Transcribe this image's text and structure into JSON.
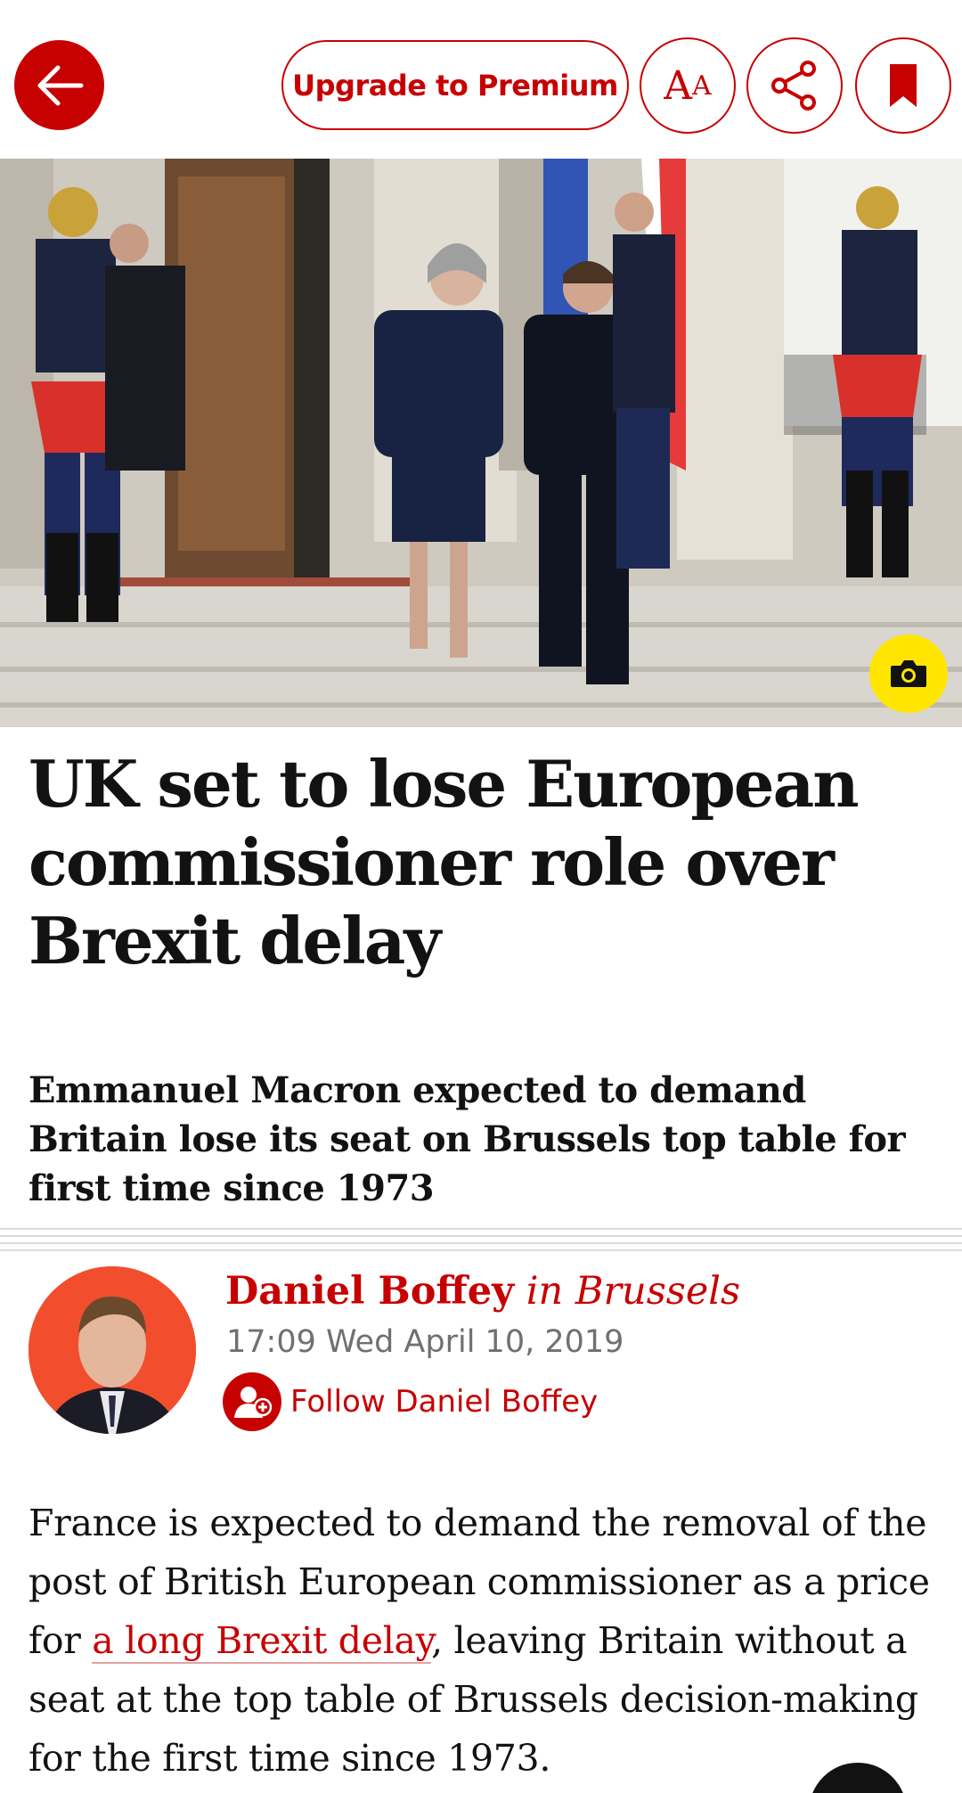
{
  "toolbar": {
    "upgrade_label": "Upgrade to Premium",
    "font_label_big": "A",
    "font_label_small": "A",
    "back_icon": "arrow-left-icon",
    "share_icon": "share-icon",
    "bookmark_icon": "bookmark-icon"
  },
  "hero": {
    "camera_icon": "camera-icon"
  },
  "article": {
    "headline": "UK set to lose European commissioner role over Brexit delay",
    "standfirst": "Emmanuel Macron expected to demand Britain lose its seat on Brussels top table for first time since 1973",
    "byline": {
      "name": "Daniel Boffey",
      "location": " in Brussels",
      "datetime": "17:09 Wed April 10, 2019",
      "follow_label": "Follow Daniel Boffey"
    },
    "body": {
      "part1": "France is expected to demand the removal of the post of British European commissioner as a price for ",
      "link": "a long Brexit delay",
      "part2": ", leaving Britain without a seat at the top table of Brussels decision-making for the first time since 1973."
    }
  },
  "colors": {
    "accent": "#c70000",
    "camera_badge": "#ffe500",
    "avatar_bg": "#f24e2e"
  }
}
